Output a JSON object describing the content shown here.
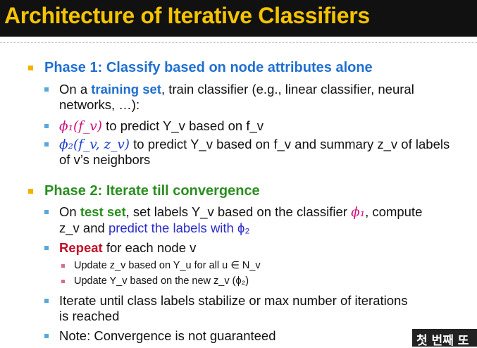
{
  "title": "Architecture of  Iterative Classifiers",
  "phase1": {
    "heading": "Phase 1: Classify based on node attributes alone",
    "item1": {
      "pre": "On a ",
      "link": "training set",
      "post": ", train classifier (e.g., linear classifier, neural",
      "cont": "networks, …):"
    },
    "item2": {
      "math": "ϕ₁(f_v)",
      "text": " to predict Y_v based on f_v"
    },
    "item3": {
      "math": "ϕ₂(f_v, z_v)",
      "text": " to predict Y_v based on f_v and summary z_v of labels",
      "cont": "of v’s neighbors"
    }
  },
  "phase2": {
    "heading": "Phase 2: Iterate till convergence",
    "item1": {
      "pre": "On ",
      "link": "test set",
      "post": ", set labels Y_v based on the classifier ",
      "math": "ϕ₁",
      "post2": ", compute",
      "cont_pre": "z_v and ",
      "cont_link": "predict the labels with ϕ₂"
    },
    "item2": {
      "keyword": "Repeat",
      "text": " for each node v"
    },
    "sub1": "Update z_v based on Y_u for all u ∈ N_v",
    "sub2": "Update Y_v based on the new z_v (ϕ₂)",
    "item3": {
      "text": "Iterate until class labels stabilize or max number of iterations",
      "cont": "is reached"
    },
    "item4": "Note: Convergence is not guaranteed"
  },
  "overlay_text": "첫 번째 또",
  "colors": {
    "title": "#f5c400",
    "title_bar": "#111111",
    "phase1": "#1f6fd0",
    "phase2": "#2a8f20",
    "repeat": "#c0102a",
    "math_red": "#d0107a",
    "math_blue": "#1f3fd0"
  }
}
